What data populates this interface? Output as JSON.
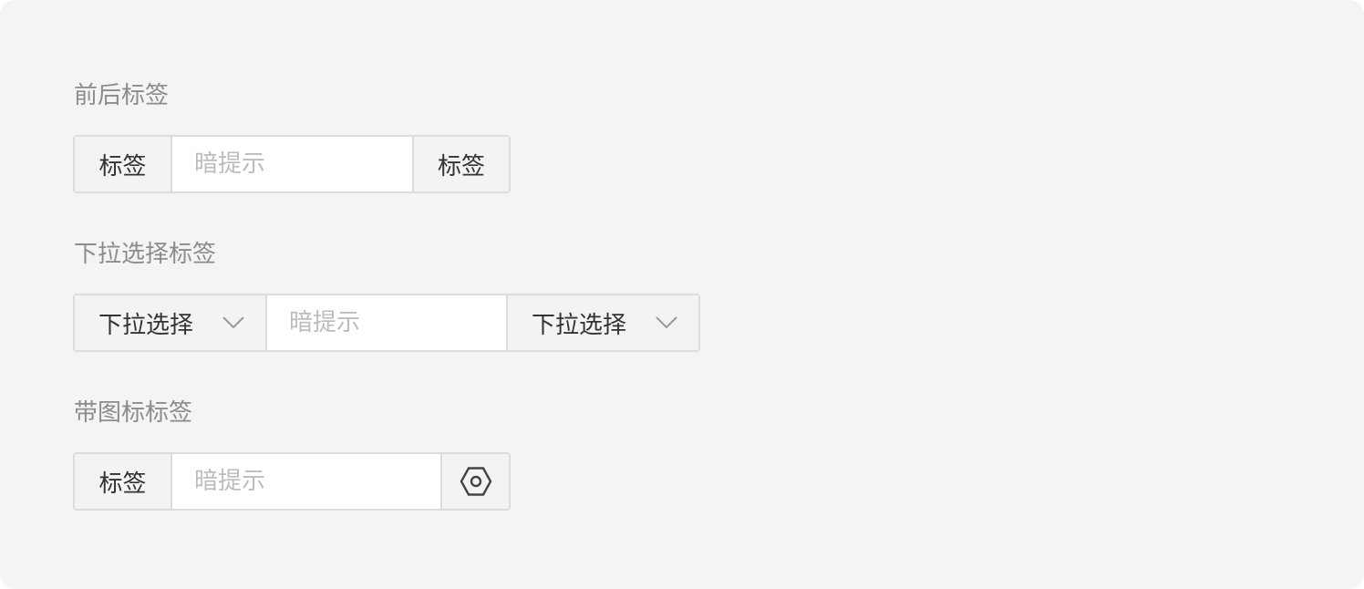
{
  "sections": [
    {
      "title": "前后标签",
      "prefix": "标签",
      "placeholder": "暗提示",
      "suffix": "标签"
    },
    {
      "title": "下拉选择标签",
      "prefix_select": "下拉选择",
      "placeholder": "暗提示",
      "suffix_select": "下拉选择",
      "chevron_icon": "chevron-down-icon"
    },
    {
      "title": "带图标标签",
      "prefix": "标签",
      "placeholder": "暗提示",
      "suffix_icon": "hexagon-settings-icon"
    }
  ],
  "colors": {
    "background": "#f4f4f4",
    "addon_background": "#f3f3f3",
    "border": "#dcdcdc",
    "label_text": "#8c8c8c",
    "addon_text": "#333333",
    "placeholder_text": "#bcbcbc"
  }
}
